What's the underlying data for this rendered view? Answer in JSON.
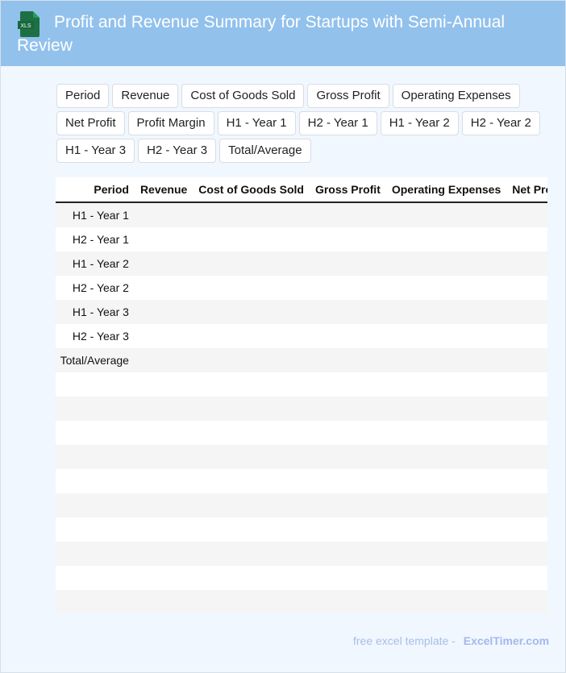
{
  "header": {
    "title": "Profit and Revenue Summary for Startups with Semi-Annual Review",
    "logo_text": "XLS"
  },
  "chips": [
    "Period",
    "Revenue",
    "Cost of Goods Sold",
    "Gross Profit",
    "Operating Expenses",
    "Net Profit",
    "Profit Margin",
    "H1 - Year 1",
    "H2 - Year 1",
    "H1 - Year 2",
    "H2 - Year 2",
    "H1 - Year 3",
    "H2 - Year 3",
    "Total/Average"
  ],
  "table": {
    "columns": [
      "",
      "Period",
      "Revenue",
      "Cost of Goods Sold",
      "Gross Profit",
      "Operating Expenses",
      "Net Profit"
    ],
    "rows": [
      {
        "index": "0",
        "period": "H1 - Year 1"
      },
      {
        "index": "1",
        "period": "H2 - Year 1"
      },
      {
        "index": "2",
        "period": "H1 - Year 2"
      },
      {
        "index": "3",
        "period": "H2 - Year 2"
      },
      {
        "index": "4",
        "period": "H1 - Year 3"
      },
      {
        "index": "5",
        "period": "H2 - Year 3"
      },
      {
        "index": "6",
        "period": "Total/Average"
      },
      {
        "index": "7",
        "period": ""
      },
      {
        "index": "8",
        "period": ""
      },
      {
        "index": "9",
        "period": ""
      },
      {
        "index": "10",
        "period": ""
      },
      {
        "index": "11",
        "period": ""
      },
      {
        "index": "12",
        "period": ""
      },
      {
        "index": "13",
        "period": ""
      },
      {
        "index": "14",
        "period": ""
      },
      {
        "index": "15",
        "period": ""
      },
      {
        "index": "16",
        "period": ""
      }
    ]
  },
  "footer": {
    "text": "free excel template -",
    "brand": "ExcelTimer.com"
  },
  "colors": {
    "header_bg": "#92c1ec",
    "page_bg": "#f0f7ff",
    "footer_text": "#a9bde9"
  }
}
